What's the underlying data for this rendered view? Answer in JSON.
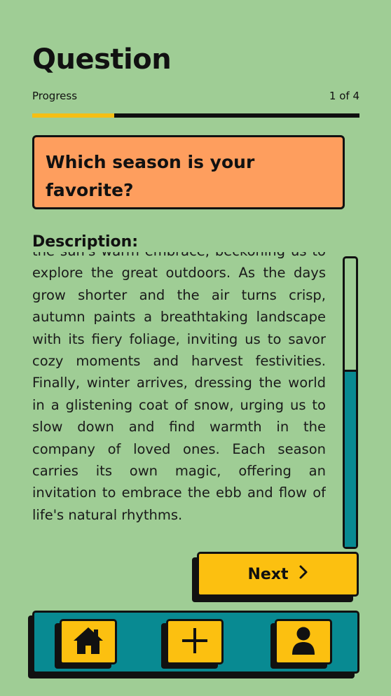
{
  "header": {
    "title": "Question",
    "progress_label": "Progress",
    "progress_count": "1 of 4",
    "progress_fraction": 0.25
  },
  "question": {
    "text": "Which season is your favorite?"
  },
  "description": {
    "label": "Description:",
    "text": "the sun's warm embrace, beckoning us to explore the great outdoors. As the days grow shorter and the air turns crisp, autumn paints a breathtaking landscape with its fiery foliage, inviting us to savor cozy moments and harvest festivities. Finally, winter arrives, dressing the world in a glistening coat of snow, urging us to slow down and find warmth in the company of loved ones. Each season carries its own magic, offering an invitation to embrace the ebb and flow of life's natural rhythms."
  },
  "actions": {
    "next_label": "Next",
    "next_icon": "chevron-right-icon"
  },
  "nav": {
    "items": [
      {
        "name": "home",
        "icon": "home-icon"
      },
      {
        "name": "add",
        "icon": "plus-icon"
      },
      {
        "name": "profile",
        "icon": "user-icon"
      }
    ]
  },
  "colors": {
    "background": "#9fcd95",
    "accent_yellow": "#fcc010",
    "teal": "#088a92",
    "question_card": "#fe9e5e"
  }
}
